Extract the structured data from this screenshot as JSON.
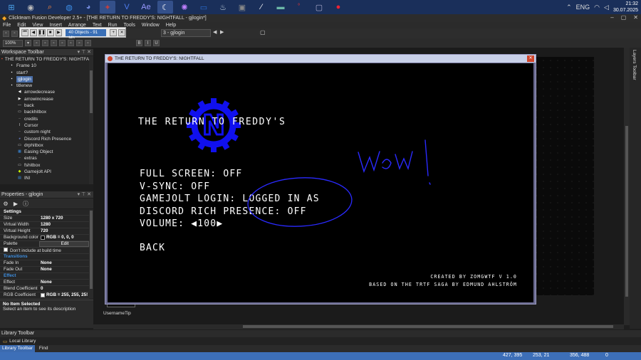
{
  "taskbar": {
    "apps": [
      {
        "name": "windows-start-icon",
        "glyph": "⊞",
        "color": "#4aa0e8"
      },
      {
        "name": "app-icon-1",
        "glyph": "◉",
        "color": "#bbb"
      },
      {
        "name": "search-app-icon",
        "glyph": "⌕",
        "color": "#ff8a3d"
      },
      {
        "name": "browser-icon",
        "glyph": "◍",
        "color": "#3d8fe8"
      },
      {
        "name": "discord-icon",
        "glyph": "◕",
        "color": "#7289da"
      },
      {
        "name": "ai-icon",
        "glyph": "✦",
        "color": "#c04040"
      },
      {
        "name": "vegas-icon",
        "glyph": "V",
        "color": "#4f7df0"
      },
      {
        "name": "after-effects-icon",
        "glyph": "Ae",
        "color": "#9999ff"
      },
      {
        "name": "nightfall-icon",
        "glyph": "☾",
        "color": "#ffffff"
      },
      {
        "name": "game-launcher-icon",
        "glyph": "✺",
        "color": "#c080ff"
      },
      {
        "name": "folder-icon",
        "glyph": "▭",
        "color": "#2b6fd6"
      },
      {
        "name": "steam-icon",
        "glyph": "♨",
        "color": "#c7d5e0"
      },
      {
        "name": "photos-icon",
        "glyph": "▣",
        "color": "#888"
      },
      {
        "name": "editor-icon",
        "glyph": "⁄",
        "color": "#fff"
      },
      {
        "name": "monitor-icon",
        "glyph": "▬",
        "color": "#6cb8a8"
      },
      {
        "name": "char-icon",
        "glyph": "ﾟ",
        "color": "#e33"
      },
      {
        "name": "app-window-icon",
        "glyph": "▢",
        "color": "#aac"
      },
      {
        "name": "chrome-icon",
        "glyph": "●",
        "color": "#e23"
      }
    ],
    "time": "21:32",
    "date": "30.07.2025"
  },
  "window": {
    "title": "Clickteam Fusion Developer 2.5+ - [THE RETURN TO FREDDY'S: NIGHTFALL - gjlogin*]"
  },
  "menu": [
    "File",
    "Edit",
    "View",
    "Insert",
    "Arrange",
    "Text",
    "Run",
    "Tools",
    "Window",
    "Help"
  ],
  "toolbar": {
    "objects_status": "40 Objects - 91 Mb",
    "frame_selector": "3 - gjlogin",
    "zoom": "100%"
  },
  "workspace": {
    "header": "Workspace Toolbar",
    "tree": [
      {
        "label": "THE RETURN TO FREDDY'S: NIGHTFALL",
        "indent": 0,
        "icon": "app"
      },
      {
        "label": "Frame 10",
        "indent": 1,
        "icon": "frame"
      },
      {
        "label": "start?",
        "indent": 1,
        "icon": "frame"
      },
      {
        "label": "gjlogin",
        "indent": 1,
        "icon": "frame",
        "selected": true
      },
      {
        "label": "titlenew",
        "indent": 1,
        "icon": "frame"
      },
      {
        "label": "arrowdecrease",
        "indent": 2,
        "icon": "arrow-left"
      },
      {
        "label": "arrowincrease",
        "indent": 2,
        "icon": "arrow-right"
      },
      {
        "label": "back",
        "indent": 2,
        "icon": "line"
      },
      {
        "label": "backhitbox",
        "indent": 2,
        "icon": "box"
      },
      {
        "label": "credits",
        "indent": 2,
        "icon": "dash"
      },
      {
        "label": "Cursor",
        "indent": 2,
        "icon": "cursor"
      },
      {
        "label": "custom night",
        "indent": 2,
        "icon": "dash"
      },
      {
        "label": "Discord Rich Presence",
        "indent": 2,
        "icon": "discord"
      },
      {
        "label": "drphitbox",
        "indent": 2,
        "icon": "box"
      },
      {
        "label": "Easing Object",
        "indent": 2,
        "icon": "easing"
      },
      {
        "label": "extras",
        "indent": 2,
        "icon": "dash"
      },
      {
        "label": "fshitbox",
        "indent": 2,
        "icon": "box"
      },
      {
        "label": "Gamejolt API",
        "indent": 2,
        "icon": "gamejolt"
      },
      {
        "label": "INI",
        "indent": 2,
        "icon": "ini"
      }
    ]
  },
  "properties": {
    "header": "Properties - gjlogin",
    "rows": [
      {
        "type": "cat",
        "key": "Settings"
      },
      {
        "key": "Size",
        "value": "1280 x 720"
      },
      {
        "key": "Virtual Width",
        "value": "1280"
      },
      {
        "key": "Virtual Height",
        "value": "720"
      },
      {
        "key": "Background color",
        "value": "RGB = 0, 0, 0",
        "swatch": "#000000"
      },
      {
        "key": "Palette",
        "value": "Edit",
        "button": true
      },
      {
        "key": "Don't include at build time",
        "value": "",
        "checkbox": true
      },
      {
        "type": "sub",
        "key": "Transitions"
      },
      {
        "key": "Fade In",
        "value": "None"
      },
      {
        "key": "Fade Out",
        "value": "None"
      },
      {
        "type": "sub",
        "key": "Effect"
      },
      {
        "key": "Effect",
        "value": "None"
      },
      {
        "key": "Blend Coefficient",
        "value": "0"
      },
      {
        "key": "RGB Coefficient",
        "value": "RGB = 255, 255, 25!",
        "swatch": "#ffffff"
      }
    ],
    "selection_title": "No Item Selected",
    "selection_desc": "Select an item to see its description"
  },
  "library": {
    "header": "Library Toolbar",
    "local": "Local Library",
    "tabs": [
      "Library Toolbar",
      "Find"
    ]
  },
  "layers": {
    "label": "Layers Toolbar"
  },
  "editor": {
    "tip": "UsernameTip"
  },
  "status": {
    "coord1": "427, 395",
    "coord2": "253, 21",
    "coord3": "356, 488",
    "coord4": "0"
  },
  "game": {
    "window_title": "THE RETURN TO FREDDY'S: NIGHTFALL",
    "title": "THE RETURN TO FREDDY'S",
    "options": {
      "fullscreen": "FULL SCREEN:  OFF",
      "vsync": "V-SYNC:  OFF",
      "gamejolt": "GAMEJOLT LOGIN:  LOGGED IN AS",
      "discord": "DISCORD RICH PRESENCE:  OFF",
      "volume_label": "VOLUME:",
      "volume_value": "100",
      "back": "BACK"
    },
    "credit1": "CREATED BY ZOMGWTF V 1.0",
    "credit2": "BASED ON THE TRTF SAGA BY EDMUND AHLSTRÖM",
    "logo_letter": "N",
    "scribble_text": "Wow!",
    "scribble_color": "#2a2aff",
    "logo_color": "#1010ee"
  }
}
